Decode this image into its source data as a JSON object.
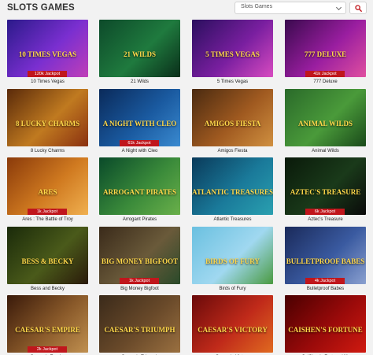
{
  "header": {
    "title": "SLOTS GAMES",
    "select_value": "Slots Games"
  },
  "games": [
    {
      "name": "10 Times Vegas",
      "logo": "10 TIMES VEGAS",
      "jackpot": "120k Jackpot",
      "colors": [
        "#2b1a8a",
        "#7a2fd0",
        "#c03fb8"
      ]
    },
    {
      "name": "21 Wilds",
      "logo": "21 WILDS",
      "jackpot": "",
      "colors": [
        "#0d4a2a",
        "#1f7a3e",
        "#0a2e1a"
      ]
    },
    {
      "name": "5 Times Vegas",
      "logo": "5 TIMES VEGAS",
      "jackpot": "",
      "colors": [
        "#2a0f5e",
        "#7a1fa0",
        "#d84bc0"
      ]
    },
    {
      "name": "777 Deluxe",
      "logo": "777 DELUXE",
      "jackpot": "41k Jackpot",
      "colors": [
        "#3a0a4e",
        "#9a1ea0",
        "#e04fa0"
      ]
    },
    {
      "name": "8 Lucky Charms",
      "logo": "8 LUCKY CHARMS",
      "jackpot": "",
      "colors": [
        "#5a2a0a",
        "#c07a20",
        "#8a3010"
      ]
    },
    {
      "name": "A Night with Cleo",
      "logo": "A NIGHT WITH CLEO",
      "jackpot": "61k Jackpot",
      "colors": [
        "#0a2a5a",
        "#1a5aa0",
        "#3a8ad0"
      ]
    },
    {
      "name": "Amigos Fiesta",
      "logo": "AMIGOS FIESTA",
      "jackpot": "",
      "colors": [
        "#4a2a10",
        "#a05a20",
        "#d09040"
      ]
    },
    {
      "name": "Animal Wilds",
      "logo": "ANIMAL WILDS",
      "jackpot": "",
      "colors": [
        "#2a6a2a",
        "#4a9a3a",
        "#1a4a1a"
      ]
    },
    {
      "name": "Ares : The Battle of Troy",
      "logo": "ARES",
      "jackpot": "1k Jackpot",
      "colors": [
        "#8a3a0a",
        "#d07a20",
        "#f0b050"
      ]
    },
    {
      "name": "Arrogant Pirates",
      "logo": "ARROGANT PIRATES",
      "jackpot": "",
      "colors": [
        "#0a4a2a",
        "#3a8a3a",
        "#6ab04a"
      ]
    },
    {
      "name": "Atlantic Treasures",
      "logo": "ATLANTIC TREASURES",
      "jackpot": "",
      "colors": [
        "#0a3a5a",
        "#1a7a9a",
        "#2aa0b0"
      ]
    },
    {
      "name": "Aztec's Treasure",
      "logo": "AZTEC'S TREASURE",
      "jackpot": "6k Jackpot",
      "colors": [
        "#0a1a0a",
        "#1a3a1a",
        "#0a0a0a"
      ]
    },
    {
      "name": "Bess and Becky",
      "logo": "BESS & BECKY",
      "jackpot": "",
      "colors": [
        "#1a2a0a",
        "#4a5a1a",
        "#2a1a0a"
      ]
    },
    {
      "name": "Big Money Bigfoot",
      "logo": "BIG MONEY BIGFOOT",
      "jackpot": "1k Jackpot",
      "colors": [
        "#3a2a1a",
        "#6a5a3a",
        "#2a4a2a"
      ]
    },
    {
      "name": "Birds of Fury",
      "logo": "BIRDS OF FURY",
      "jackpot": "",
      "colors": [
        "#6ac0e0",
        "#a0d8f0",
        "#4a9a40"
      ]
    },
    {
      "name": "Bulletproof Babes",
      "logo": "BULLETPROOF BABES",
      "jackpot": "4k Jackpot",
      "colors": [
        "#1a2a5a",
        "#3a5aa0",
        "#8aa0d0"
      ]
    },
    {
      "name": "Caesar's Empire",
      "logo": "CAESAR'S EMPIRE",
      "jackpot": "2k Jackpot",
      "colors": [
        "#3a1a0a",
        "#8a5a2a",
        "#c09050"
      ]
    },
    {
      "name": "Caesar's Triumph",
      "logo": "CAESAR'S TRIUMPH",
      "jackpot": "",
      "colors": [
        "#3a2a1a",
        "#6a4a2a",
        "#9a7040"
      ]
    },
    {
      "name": "Caesar's Victory",
      "logo": "CAESAR'S VICTORY",
      "jackpot": "",
      "colors": [
        "#6a0a0a",
        "#c02a1a",
        "#e06a20"
      ]
    },
    {
      "name": "CaiShen's Fortune WL",
      "logo": "CAISHEN'S FORTUNE",
      "jackpot": "",
      "colors": [
        "#4a0000",
        "#9a0a0a",
        "#d01a10"
      ]
    }
  ]
}
